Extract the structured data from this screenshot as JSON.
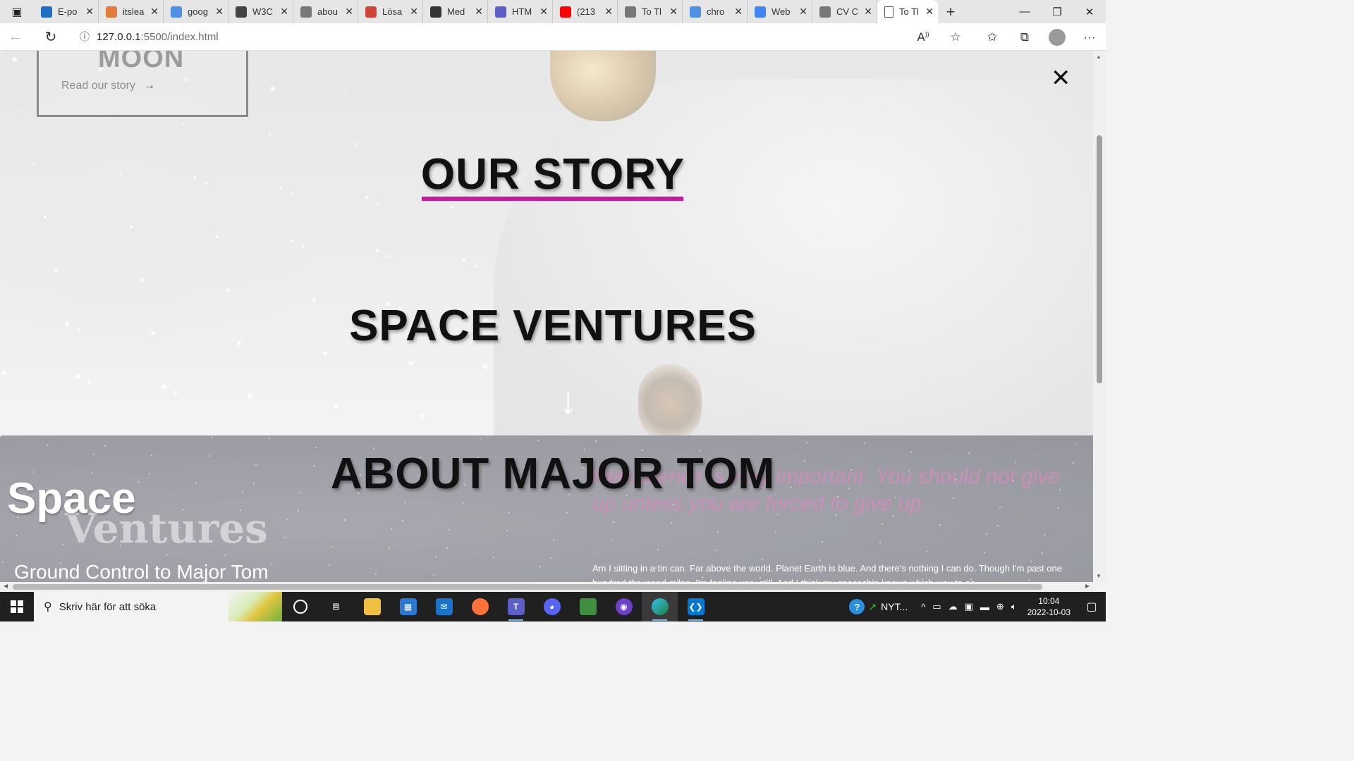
{
  "browser": {
    "tabs": [
      {
        "title": "E-po",
        "icon": "outlook-icon",
        "color": "#1f6fc5"
      },
      {
        "title": "itslea",
        "icon": "its-icon",
        "color": "#e07b39"
      },
      {
        "title": "goog",
        "icon": "search-icon",
        "color": "#4f8fe6"
      },
      {
        "title": "W3C",
        "icon": "w3c-icon",
        "color": "#444444"
      },
      {
        "title": "abou",
        "icon": "page-icon",
        "color": "#777777"
      },
      {
        "title": "Lösa",
        "icon": "pin-icon",
        "color": "#d0453a"
      },
      {
        "title": "Med",
        "icon": "github-icon",
        "color": "#333333"
      },
      {
        "title": "HTM",
        "icon": "teams-icon",
        "color": "#5b5fc7"
      },
      {
        "title": "(213",
        "icon": "youtube-icon",
        "color": "#ff0000"
      },
      {
        "title": "To Tl",
        "icon": "page-icon",
        "color": "#777777"
      },
      {
        "title": "chro",
        "icon": "search-icon",
        "color": "#4f8fe6"
      },
      {
        "title": "Web",
        "icon": "google-icon",
        "color": "#4285f4"
      },
      {
        "title": "CV C",
        "icon": "page-icon",
        "color": "#777777"
      }
    ],
    "active_tab": {
      "title": "To Tl",
      "icon": "page-icon"
    },
    "url": {
      "host": "127.0.0.1",
      "path": ":5500/index.html"
    }
  },
  "page": {
    "card": {
      "title": "MOON",
      "link": "Read our story"
    },
    "menu": {
      "close": "✕",
      "items": [
        "OUR STORY",
        "SPACE VENTURES",
        "ABOUT MAJOR TOM"
      ],
      "active_underline_color": "#c8169d"
    },
    "logo": {
      "line1": "Space",
      "line2": "Ventures"
    },
    "ground_control": "Ground Control to Major Tom",
    "quote": "Persistence is very important. You should not give up unless you are forced to give up.",
    "lyrics": "Am I sitting in a tin can. Far above the world. Planet Earth is blue. And there's nothing I can do. Though I'm past one hundred thousand miles, I'm feeling very still. And I think my spaceship knows which way to go."
  },
  "taskbar": {
    "search_placeholder": "Skriv här för att söka",
    "news": "NYT...",
    "time": "10:04",
    "date": "2022-10-03"
  }
}
